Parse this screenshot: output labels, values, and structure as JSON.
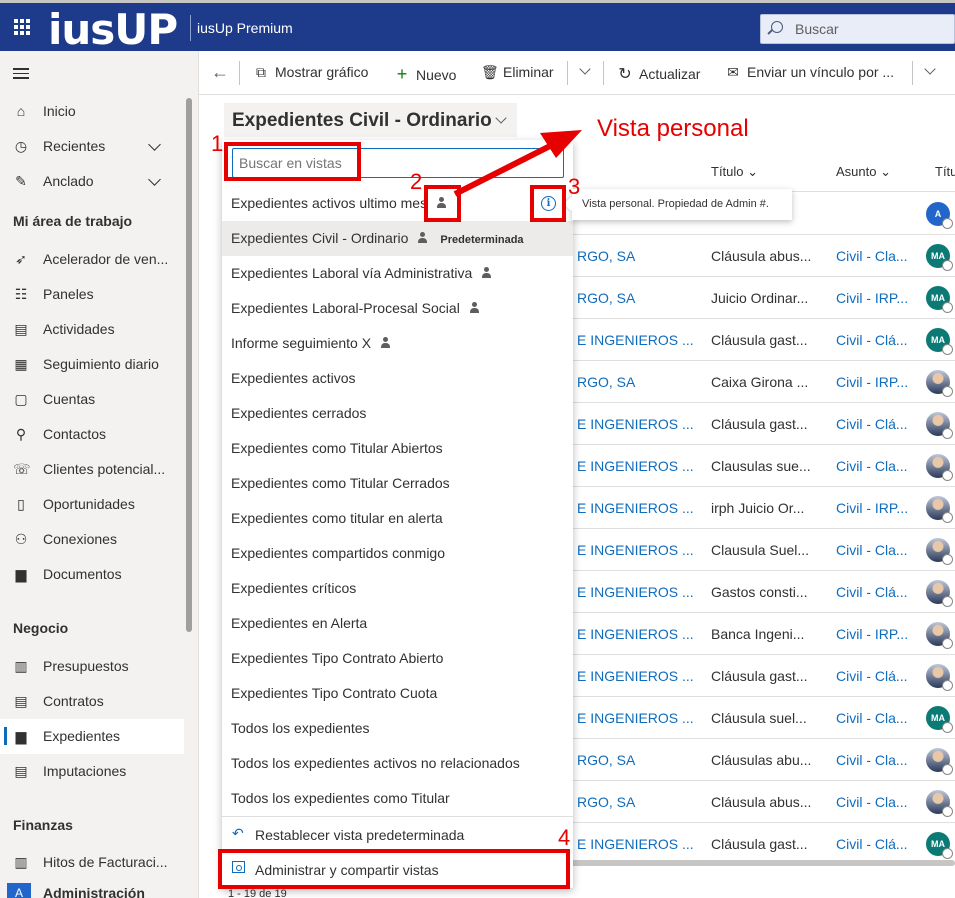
{
  "header": {
    "logo_text": "iusUP",
    "app_title": "iusUp Premium",
    "search_placeholder": "Buscar"
  },
  "sidebar": {
    "items": [
      {
        "label": "Inicio",
        "icon": "home-icon"
      },
      {
        "label": "Recientes",
        "icon": "clock-icon"
      },
      {
        "label": "Anclado",
        "icon": "pin-icon"
      }
    ],
    "groups": [
      {
        "title": "Mi área de trabajo",
        "items": [
          {
            "label": "Acelerador de ven...",
            "icon": "rocket-icon"
          },
          {
            "label": "Paneles",
            "icon": "dashboard-icon"
          },
          {
            "label": "Actividades",
            "icon": "clipboard-icon"
          },
          {
            "label": "Seguimiento diario",
            "icon": "tracking-icon"
          },
          {
            "label": "Cuentas",
            "icon": "building-icon"
          },
          {
            "label": "Contactos",
            "icon": "person-icon"
          },
          {
            "label": "Clientes potencial...",
            "icon": "phone-person-icon"
          },
          {
            "label": "Oportunidades",
            "icon": "opportunity-icon"
          },
          {
            "label": "Conexiones",
            "icon": "connections-icon"
          },
          {
            "label": "Documentos",
            "icon": "folder-icon"
          }
        ]
      },
      {
        "title": "Negocio",
        "items": [
          {
            "label": "Presupuestos",
            "icon": "quote-icon"
          },
          {
            "label": "Contratos",
            "icon": "contract-icon"
          },
          {
            "label": "Expedientes",
            "icon": "folder-icon"
          },
          {
            "label": "Imputaciones",
            "icon": "clipboard-icon"
          }
        ]
      },
      {
        "title": "Finanzas",
        "items": [
          {
            "label": "Hitos de Facturaci...",
            "icon": "invoice-icon"
          }
        ]
      }
    ],
    "area_badge": "A",
    "area_label": "Administración"
  },
  "commands": {
    "show_chart": "Mostrar gráfico",
    "new": "Nuevo",
    "delete": "Eliminar",
    "refresh": "Actualizar",
    "email_link": "Enviar un vínculo por ..."
  },
  "view": {
    "title": "Expedientes Civil - Ordinario"
  },
  "view_selector": {
    "search_placeholder": "Buscar en vistas",
    "default_tag": "Predeterminada",
    "items": [
      "Expedientes activos ultimo mes",
      "Expedientes Civil - Ordinario",
      "Expedientes Laboral vía Administrativa",
      "Expedientes Laboral-Procesal Social",
      "Informe seguimiento X",
      "Expedientes activos",
      "Expedientes cerrados",
      "Expedientes como Titular Abiertos",
      "Expedientes como Titular Cerrados",
      "Expedientes como titular en alerta",
      "Expedientes compartidos conmigo",
      "Expedientes críticos",
      "Expedientes en Alerta",
      "Expedientes Tipo Contrato Abierto",
      "Expedientes Tipo Contrato Cuota",
      "Todos los expedientes",
      "Todos los expedientes activos no relacionados",
      "Todos los expedientes como Titular"
    ],
    "reset_label": "Restablecer vista predeterminada",
    "manage_label": "Administrar y compartir vistas",
    "tooltip": "Vista personal. Propiedad de Admin #."
  },
  "grid": {
    "columns": [
      "Título",
      "Asunto",
      "Títu"
    ],
    "rows": [
      {
        "c1": "",
        "titulo": "",
        "asunto": "",
        "avatar": "A"
      },
      {
        "c1": "RGO, SA",
        "titulo": "Cláusula abus...",
        "asunto": "Civil - Cla...",
        "avatar": "MA"
      },
      {
        "c1": "RGO, SA",
        "titulo": "Juicio Ordinar...",
        "asunto": "Civil - IRP...",
        "avatar": "MA"
      },
      {
        "c1": "E INGENIEROS ...",
        "titulo": "Cláusula gast...",
        "asunto": "Civil - Clá...",
        "avatar": "MA"
      },
      {
        "c1": "RGO, SA",
        "titulo": "Caixa Girona ...",
        "asunto": "Civil - IRP...",
        "avatar": ""
      },
      {
        "c1": "E INGENIEROS ...",
        "titulo": "Cláusula gast...",
        "asunto": "Civil - Clá...",
        "avatar": ""
      },
      {
        "c1": "E INGENIEROS ...",
        "titulo": "Clausulas sue...",
        "asunto": "Civil - Cla...",
        "avatar": ""
      },
      {
        "c1": "E INGENIEROS ...",
        "titulo": "irph Juicio Or...",
        "asunto": "Civil - IRP...",
        "avatar": ""
      },
      {
        "c1": "E INGENIEROS ...",
        "titulo": "Clausula Suel...",
        "asunto": "Civil - Cla...",
        "avatar": ""
      },
      {
        "c1": "E INGENIEROS ...",
        "titulo": "Gastos consti...",
        "asunto": "Civil - Clá...",
        "avatar": ""
      },
      {
        "c1": "E INGENIEROS ...",
        "titulo": "Banca Ingeni...",
        "asunto": "Civil - IRP...",
        "avatar": ""
      },
      {
        "c1": "E INGENIEROS ...",
        "titulo": "Cláusula gast...",
        "asunto": "Civil - Clá...",
        "avatar": ""
      },
      {
        "c1": "E INGENIEROS ...",
        "titulo": "Cláusula suel...",
        "asunto": "Civil - Cla...",
        "avatar": "MA"
      },
      {
        "c1": "RGO, SA",
        "titulo": "Cláusulas abu...",
        "asunto": "Civil - Cla...",
        "avatar": ""
      },
      {
        "c1": "RGO, SA",
        "titulo": "Cláusula abus...",
        "asunto": "Civil - Cla...",
        "avatar": ""
      },
      {
        "c1": "E INGENIEROS ...",
        "titulo": "Cláusula gast...",
        "asunto": "Civil - Clá...",
        "avatar": "MA"
      }
    ],
    "pager": "1 - 19 de 19"
  },
  "annotations": {
    "label": "Vista personal",
    "numbers": [
      "1",
      "2",
      "3",
      "4"
    ]
  },
  "colors": {
    "header": "#1e3a8a",
    "accent": "#0f6cbd",
    "annotation": "#e60000",
    "avatar_teal": "#0b7a75",
    "avatar_blue": "#2266cc"
  }
}
